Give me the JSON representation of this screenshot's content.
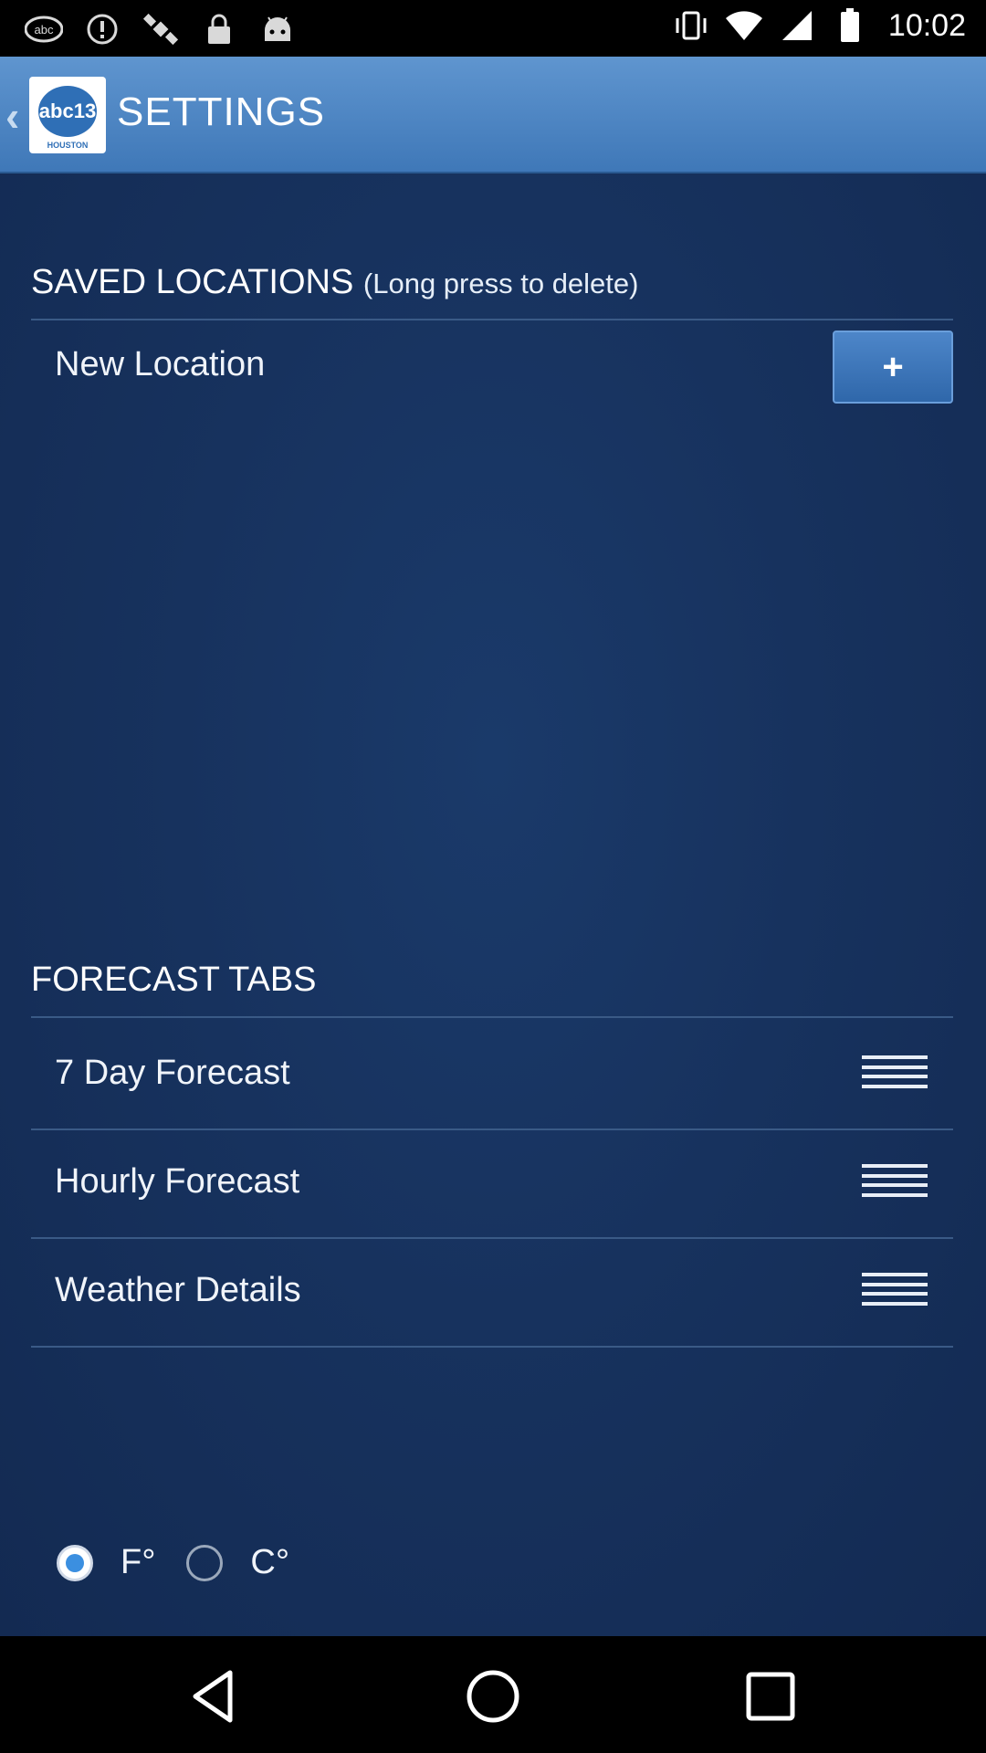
{
  "status_bar": {
    "time": "10:02",
    "icons_left": [
      "abc13-notification-icon",
      "info-icon",
      "fake-gps-satellite-icon",
      "lock-icon",
      "android-icon"
    ],
    "icons_right": [
      "vibrate-icon",
      "wifi-icon",
      "signal-icon",
      "battery-icon"
    ]
  },
  "app_bar": {
    "logo_text": "abc13",
    "logo_sub": "HOUSTON",
    "title": "SETTINGS"
  },
  "saved_locations": {
    "header": "SAVED LOCATIONS",
    "hint": "(Long press to delete)",
    "new_location_label": "New Location",
    "add_button_label": "+"
  },
  "forecast_tabs": {
    "header": "FORECAST TABS",
    "items": [
      {
        "label": "7 Day Forecast"
      },
      {
        "label": "Hourly Forecast"
      },
      {
        "label": "Weather Details"
      }
    ]
  },
  "units": {
    "options": [
      {
        "label": "F°",
        "selected": true
      },
      {
        "label": "C°",
        "selected": false
      }
    ]
  },
  "colors": {
    "app_bar": "#4a85c4",
    "background": "#17325e",
    "accent": "#3b8fe0"
  }
}
